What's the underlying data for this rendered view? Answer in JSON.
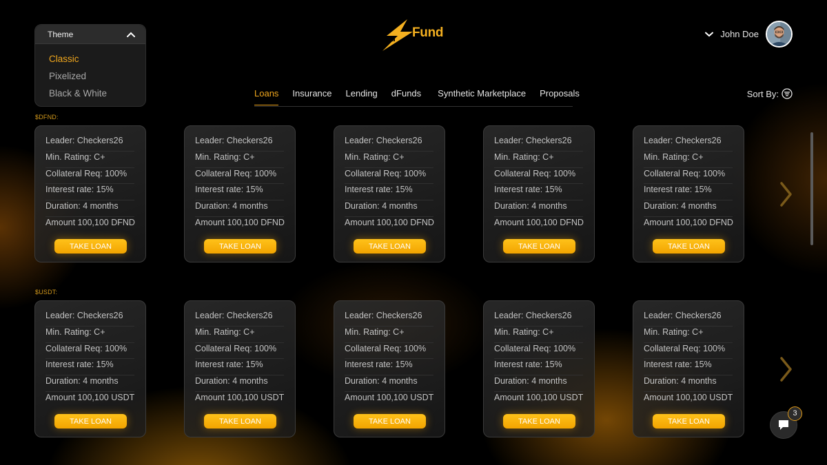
{
  "theme": {
    "label": "Theme",
    "options": [
      {
        "label": "Classic",
        "active": true
      },
      {
        "label": "Pixelized",
        "active": false
      },
      {
        "label": "Black & White",
        "active": false
      }
    ]
  },
  "logo": {
    "prefix": "d",
    "text": "Fund"
  },
  "user": {
    "name": "John Doe"
  },
  "nav": {
    "tabs": [
      {
        "label": "Loans",
        "active": true
      },
      {
        "label": "Insurance",
        "active": false
      },
      {
        "label": "Lending",
        "active": false
      },
      {
        "label": "dFunds",
        "active": false
      },
      {
        "label": "Synthetic Marketplace",
        "active": false
      },
      {
        "label": "Proposals",
        "active": false
      }
    ],
    "sort_label": "Sort By:"
  },
  "sections": [
    {
      "label": "$DFND:",
      "cards": [
        {
          "leader": "Leader: Checkers26",
          "rating": "Min. Rating: C+",
          "collateral": "Collateral Req: 100%",
          "interest": "Interest rate: 15%",
          "duration": "Duration: 4 months",
          "amount": "Amount 100,100 DFND",
          "button": "TAKE LOAN"
        },
        {
          "leader": "Leader: Checkers26",
          "rating": "Min. Rating: C+",
          "collateral": "Collateral Req: 100%",
          "interest": "Interest rate: 15%",
          "duration": "Duration: 4 months",
          "amount": "Amount 100,100 DFND",
          "button": "TAKE LOAN"
        },
        {
          "leader": "Leader: Checkers26",
          "rating": "Min. Rating: C+",
          "collateral": "Collateral Req: 100%",
          "interest": "Interest rate: 15%",
          "duration": "Duration: 4 months",
          "amount": "Amount 100,100 DFND",
          "button": "TAKE LOAN"
        },
        {
          "leader": "Leader: Checkers26",
          "rating": "Min. Rating: C+",
          "collateral": "Collateral Req: 100%",
          "interest": "Interest rate: 15%",
          "duration": "Duration: 4 months",
          "amount": "Amount 100,100 DFND",
          "button": "TAKE LOAN"
        },
        {
          "leader": "Leader: Checkers26",
          "rating": "Min. Rating: C+",
          "collateral": "Collateral Req: 100%",
          "interest": "Interest rate: 15%",
          "duration": "Duration: 4 months",
          "amount": "Amount 100,100 DFND",
          "button": "TAKE LOAN"
        }
      ]
    },
    {
      "label": "$USDT:",
      "cards": [
        {
          "leader": "Leader: Checkers26",
          "rating": "Min. Rating: C+",
          "collateral": "Collateral Req: 100%",
          "interest": "Interest rate: 15%",
          "duration": "Duration: 4 months",
          "amount": "Amount 100,100 USDT",
          "button": "TAKE LOAN"
        },
        {
          "leader": "Leader: Checkers26",
          "rating": "Min. Rating: C+",
          "collateral": "Collateral Req: 100%",
          "interest": "Interest rate: 15%",
          "duration": "Duration: 4 months",
          "amount": "Amount 100,100 USDT",
          "button": "TAKE LOAN"
        },
        {
          "leader": "Leader: Checkers26",
          "rating": "Min. Rating: C+",
          "collateral": "Collateral Req: 100%",
          "interest": "Interest rate: 15%",
          "duration": "Duration: 4 months",
          "amount": "Amount 100,100 USDT",
          "button": "TAKE LOAN"
        },
        {
          "leader": "Leader: Checkers26",
          "rating": "Min. Rating: C+",
          "collateral": "Collateral Req: 100%",
          "interest": "Interest rate: 15%",
          "duration": "Duration: 4 months",
          "amount": "Amount 100,100 USDT",
          "button": "TAKE LOAN"
        },
        {
          "leader": "Leader: Checkers26",
          "rating": "Min. Rating: C+",
          "collateral": "Collateral Req: 100%",
          "interest": "Interest rate: 15%",
          "duration": "Duration: 4 months",
          "amount": "Amount 100,100 USDT",
          "button": "TAKE LOAN"
        }
      ]
    }
  ],
  "chat": {
    "badge_count": "3"
  },
  "colors": {
    "accent": "#f2a81d",
    "background": "#000000",
    "card": "#262626"
  }
}
